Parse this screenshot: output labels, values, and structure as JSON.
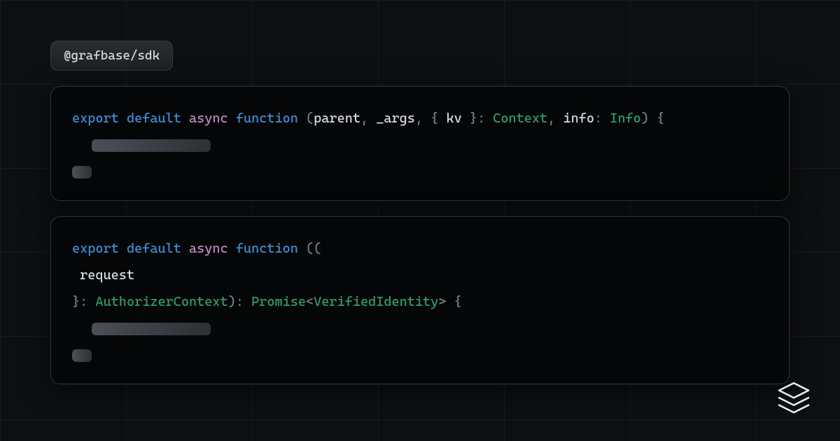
{
  "badge": {
    "label": "@grafbase/sdk"
  },
  "block1": {
    "kw_export": "export",
    "kw_default": "default",
    "kw_async": "async",
    "kw_function": "function",
    "p_lparen": "(",
    "id_parent": "parent",
    "p_comma1": ", ",
    "id_args": "_args",
    "p_comma2": ", ",
    "p_lbrace": "{ ",
    "id_kv": "kv",
    "p_rbrace_c": " }: ",
    "type_ctx": "Context",
    "p_comma3": ", ",
    "id_info": "info",
    "p_colon2": ": ",
    "type_info": "Info",
    "p_rparen": ")",
    "p_open": " {"
  },
  "block2": {
    "kw_export": "export",
    "kw_default": "default",
    "kw_async": "async",
    "kw_function": "function",
    "p_lparen": " ((",
    "id_request": " request",
    "p_close_d": "}: ",
    "type_auth": "AuthorizerContext",
    "p_rparen": "): ",
    "type_prom": "Promise",
    "p_lt": "<",
    "type_verif": "VerifiedIdentity",
    "p_gt": ">",
    "p_open": " {"
  },
  "logo": {
    "name": "grafbase-logo"
  }
}
